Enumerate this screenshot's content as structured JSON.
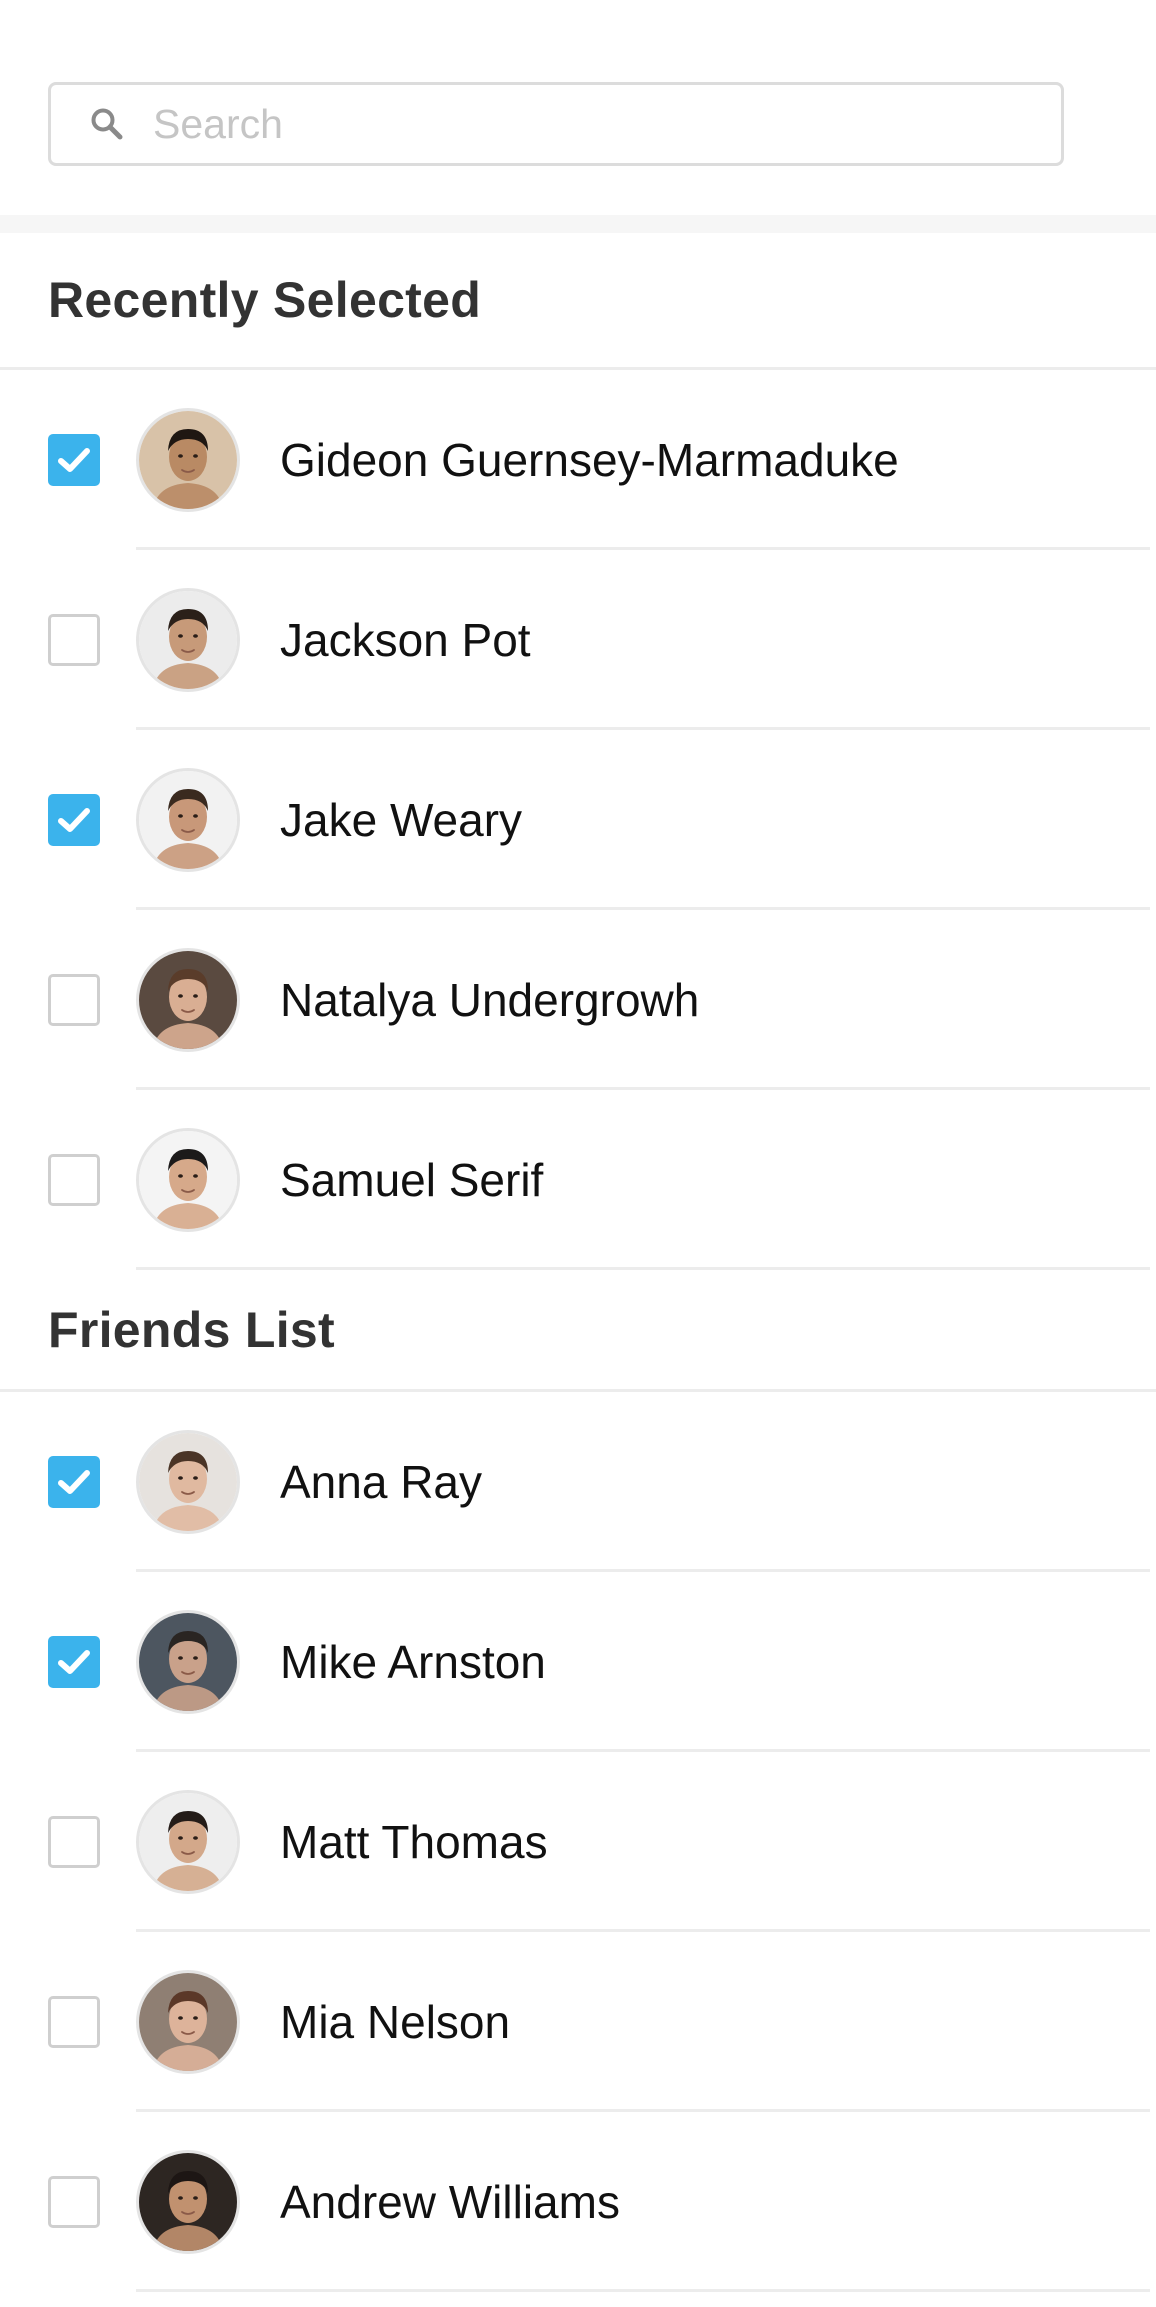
{
  "search": {
    "placeholder": "Search",
    "value": ""
  },
  "sections": [
    {
      "title": "Recently Selected",
      "contacts": [
        {
          "name": "Gideon Guernsey-Marmaduke",
          "checked": true,
          "avatar_bg": "#d8c2a8",
          "skin": "#b98a64",
          "hair": "#1f1712"
        },
        {
          "name": "Jackson Pot",
          "checked": false,
          "avatar_bg": "#ececec",
          "skin": "#c79a79",
          "hair": "#2b2019"
        },
        {
          "name": "Jake Weary",
          "checked": true,
          "avatar_bg": "#f2f2f2",
          "skin": "#c89879",
          "hair": "#3a2a1f"
        },
        {
          "name": "Natalya Undergrowh",
          "checked": false,
          "avatar_bg": "#5a4a40",
          "skin": "#d9ae93",
          "hair": "#5a3c2a"
        },
        {
          "name": "Samuel Serif",
          "checked": false,
          "avatar_bg": "#f4f4f4",
          "skin": "#d6a98a",
          "hair": "#1c1a1a"
        }
      ]
    },
    {
      "title": "Friends List",
      "contacts": [
        {
          "name": "Anna Ray",
          "checked": true,
          "avatar_bg": "#e6e2de",
          "skin": "#e0b9a0",
          "hair": "#4a3426"
        },
        {
          "name": "Mike Arnston",
          "checked": true,
          "avatar_bg": "#4d5660",
          "skin": "#c9a18a",
          "hair": "#2a2522"
        },
        {
          "name": "Matt Thomas",
          "checked": false,
          "avatar_bg": "#eeeeee",
          "skin": "#d3a88a",
          "hair": "#241c18"
        },
        {
          "name": "Mia Nelson",
          "checked": false,
          "avatar_bg": "#8f7f73",
          "skin": "#ddb39a",
          "hair": "#5b3828"
        },
        {
          "name": "Andrew Williams",
          "checked": false,
          "avatar_bg": "#2d2622",
          "skin": "#c1916f",
          "hair": "#1d1614"
        }
      ]
    }
  ],
  "colors": {
    "accent": "#3bb3ec",
    "checkbox_border": "#cfcfcf",
    "divider": "#ececec",
    "heading_text": "#333333"
  },
  "icons": {
    "search": "magnifier-icon",
    "check": "checkmark-icon",
    "avatar": "person-avatar"
  }
}
